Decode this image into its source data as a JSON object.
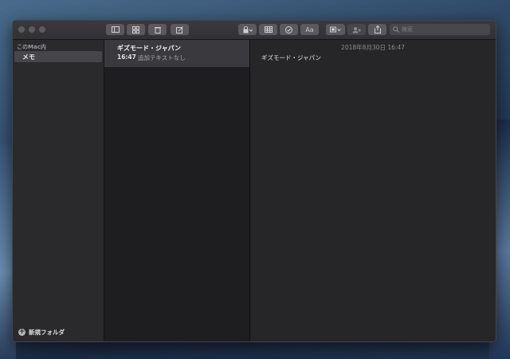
{
  "toolbar": {
    "search_placeholder": "検索",
    "buttons": [
      "sidebar-toggle",
      "gallery-view",
      "delete",
      "new-note",
      "lock",
      "table",
      "checklist",
      "format",
      "attachments",
      "collaborate",
      "share"
    ],
    "format_label": "Aa"
  },
  "sidebar": {
    "header": "このMac内",
    "items": [
      {
        "label": "メモ",
        "selected": true
      }
    ],
    "new_folder_label": "新規フォルダ"
  },
  "note_list": {
    "notes": [
      {
        "title": "ギズモード・ジャパン",
        "time": "16:47",
        "preview": "追加テキストなし"
      }
    ]
  },
  "editor": {
    "date": "2018年8月30日 16:47",
    "content": "ギズモード・ジャパン"
  }
}
